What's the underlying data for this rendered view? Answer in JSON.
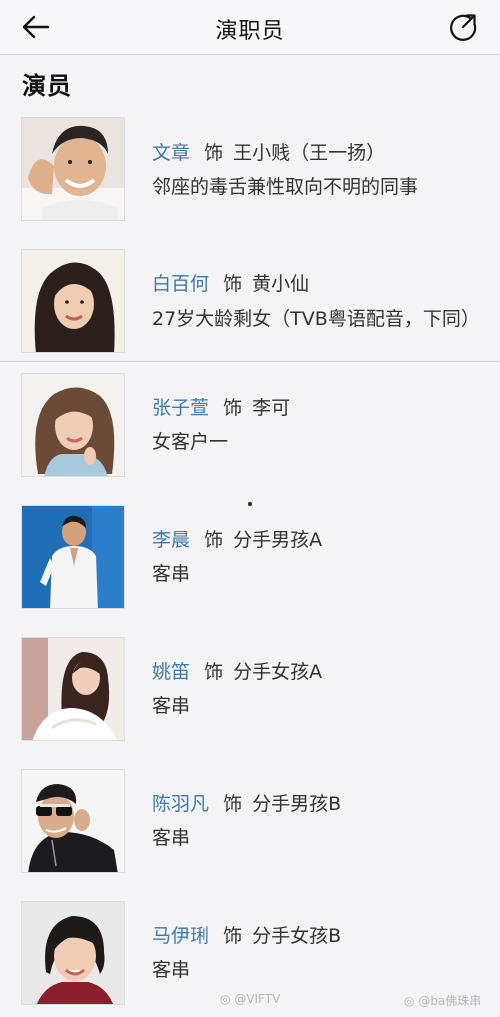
{
  "header": {
    "title": "演职员",
    "back_icon": "back-arrow-icon",
    "share_icon": "share-external-icon"
  },
  "section": {
    "title": "演员"
  },
  "cast": [
    {
      "name": "文章",
      "role_prefix": "饰",
      "role": "王小贱（王一扬）",
      "desc": "邻座的毒舌兼性取向不明的同事"
    },
    {
      "name": "白百何",
      "role_prefix": "饰",
      "role": "黄小仙",
      "desc": "27岁大龄剩女（TVB粤语配音，下同）"
    },
    {
      "name": "张子萱",
      "role_prefix": "饰",
      "role": "李可",
      "desc": "女客户一"
    },
    {
      "name": "李晨",
      "role_prefix": "饰",
      "role": "分手男孩A",
      "desc": "客串"
    },
    {
      "name": "姚笛",
      "role_prefix": "饰",
      "role": "分手女孩A",
      "desc": "客串"
    },
    {
      "name": "陈羽凡",
      "role_prefix": "饰",
      "role": "分手男孩B",
      "desc": "客串"
    },
    {
      "name": "马伊琍",
      "role_prefix": "饰",
      "role": "分手女孩B",
      "desc": "客串"
    }
  ],
  "watermarks": [
    "@VIFTV",
    "@ba佛珠串"
  ],
  "colors": {
    "actor_name": "#3f79a8",
    "background": "#f4f4f6"
  }
}
